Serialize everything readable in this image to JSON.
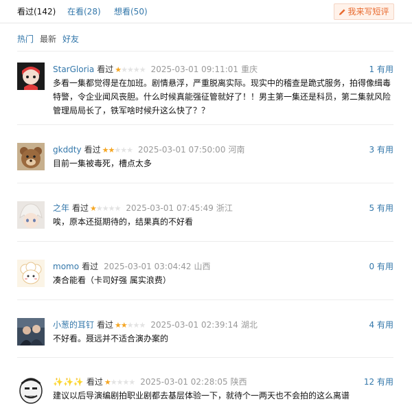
{
  "tabs": {
    "watched": "看过(142)",
    "watching": "在看(28)",
    "want": "想看(50)"
  },
  "write_button": "我来写短评",
  "sort": {
    "hot": "热门",
    "latest": "最新",
    "friends": "好友"
  },
  "colors": {
    "link": "#3377aa",
    "star": "#f5a623",
    "write_button_text": "#e86a2f",
    "write_button_bg": "#fff2ea"
  },
  "comments": [
    {
      "user": "StarGloria",
      "status": "看过",
      "rating": 1,
      "time": "2025-03-01 09:11:01",
      "location": "重庆",
      "votes": "1",
      "vote_label": "有用",
      "avatar_icon": "cartoon-girl-avatar",
      "text": "多看一集都觉得是在加班。剧情悬浮，严重脱离实际。现实中的稽查是跪式服务，拍得像缉毒特警，令企业闻风丧胆。什么时候真能强征管就好了！！男主第一集还是科员，第二集就风险管理局局长了，铁军啥时候升这么快了？？"
    },
    {
      "user": "gkddty",
      "status": "看过",
      "rating": 2,
      "time": "2025-03-01 07:50:00",
      "location": "河南",
      "votes": "3",
      "vote_label": "有用",
      "avatar_icon": "brown-bear-avatar",
      "text": "目前一集被毒死，槽点太多"
    },
    {
      "user": "之年",
      "status": "看过",
      "rating": 1,
      "time": "2025-03-01 07:45:49",
      "location": "浙江",
      "votes": "5",
      "vote_label": "有用",
      "avatar_icon": "anime-character-avatar",
      "text": "唉，原本还挺期待的，结果真的不好看"
    },
    {
      "user": "momo",
      "status": "看过",
      "rating": 0,
      "time": "2025-03-01 03:04:42",
      "location": "山西",
      "votes": "0",
      "vote_label": "有用",
      "avatar_icon": "cute-sheep-avatar",
      "text": "凑合能看（卡司好强 属实浪费）"
    },
    {
      "user": "小葱的耳钉",
      "status": "看过",
      "rating": 2,
      "time": "2025-03-01 02:39:14",
      "location": "湖北",
      "votes": "4",
      "vote_label": "有用",
      "avatar_icon": "photo-avatar",
      "text": "不好看。聂远并不适合演办案的"
    },
    {
      "user": "✨✨✨",
      "status": "看过",
      "rating": 1,
      "time": "2025-03-01 02:28:05",
      "location": "陕西",
      "votes": "12",
      "vote_label": "有用",
      "avatar_icon": "meme-face-avatar",
      "text": "建议以后导演编剧拍职业剧都去基层体验一下，就待个一两天也不会拍的这么离谱"
    }
  ]
}
